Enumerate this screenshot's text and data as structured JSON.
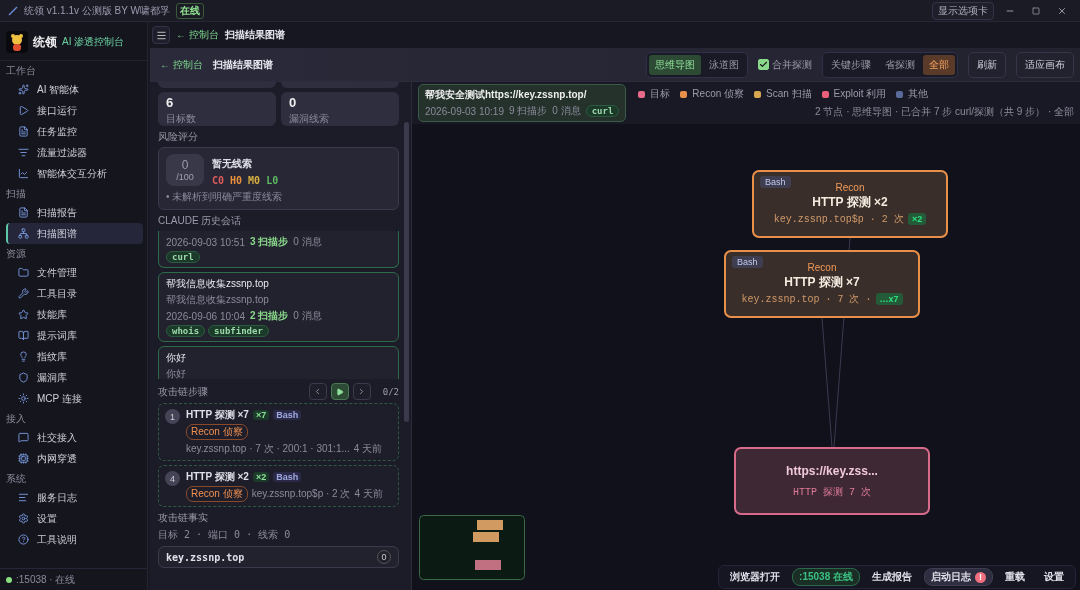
{
  "title_bar": {
    "title": "统领 v1.1.1v 公测版 BY W啸都孚",
    "status": "在线",
    "tabs_button": "显示选项卡"
  },
  "sidebar": {
    "brand": "统领",
    "subtitle": "AI 渗透控制台",
    "sections": [
      {
        "title": "工作台",
        "items": [
          {
            "label": "AI 智能体",
            "selected": false
          },
          {
            "label": "接口运行",
            "selected": false
          },
          {
            "label": "任务监控",
            "selected": false
          },
          {
            "label": "流量过滤器",
            "selected": false
          },
          {
            "label": "智能体交互分析",
            "selected": false
          }
        ]
      },
      {
        "title": "扫描",
        "items": [
          {
            "label": "扫描报告",
            "selected": false
          },
          {
            "label": "扫描图谱",
            "selected": true
          }
        ]
      },
      {
        "title": "资源",
        "items": [
          {
            "label": "文件管理",
            "selected": false
          },
          {
            "label": "工具目录",
            "selected": false
          },
          {
            "label": "技能库",
            "selected": false
          },
          {
            "label": "提示词库",
            "selected": false
          },
          {
            "label": "指纹库",
            "selected": false
          },
          {
            "label": "漏洞库",
            "selected": false
          },
          {
            "label": "MCP 连接",
            "selected": false
          }
        ]
      },
      {
        "title": "接入",
        "items": [
          {
            "label": "社交接入",
            "selected": false
          },
          {
            "label": "内网穿透",
            "selected": false
          }
        ]
      },
      {
        "title": "系统",
        "items": [
          {
            "label": "服务日志",
            "selected": false
          },
          {
            "label": "设置",
            "selected": false
          },
          {
            "label": "工具说明",
            "selected": false
          }
        ]
      }
    ],
    "footer": ":15038 · 在线"
  },
  "header": {
    "back": "← 控制台",
    "title": "扫描结果图谱"
  },
  "panel": {
    "back": "← 控制台",
    "title": "扫描结果图谱",
    "view_tabs": [
      {
        "label": "思维导图",
        "selected": true
      },
      {
        "label": "泳道图",
        "selected": false
      }
    ],
    "merge": {
      "label": "合并探测",
      "checked": true
    },
    "filter_tabs": [
      {
        "label": "关键步骤",
        "selected": false
      },
      {
        "label": "省探测",
        "selected": false
      },
      {
        "label": "全部",
        "selected": true
      }
    ],
    "buttons": [
      "刷新",
      "适应画布"
    ]
  },
  "summary": {
    "stats": [
      {
        "value": "6",
        "label": "目标数"
      },
      {
        "value": "0",
        "label": "漏洞线索"
      }
    ]
  },
  "risk": {
    "heading": "风险评分",
    "score": "0",
    "max": "/100",
    "title": "暂无线索",
    "levels": [
      {
        "label": "C0",
        "color": "#e05a5a"
      },
      {
        "label": "H0",
        "color": "#e8903a"
      },
      {
        "label": "M0",
        "color": "#d8b040"
      },
      {
        "label": "L0",
        "color": "#5cb860"
      }
    ],
    "note": "• 未解析到明确严重度线索"
  },
  "sessions": {
    "heading": "CLAUDE 历史会话",
    "items": [
      {
        "time": "2026-09-03 10:51",
        "steps": "3 扫描步",
        "messages": "0 消息",
        "tags": [
          "curl"
        ]
      },
      {
        "title": "帮我信息收集zssnp.top",
        "subtitle": "帮我信息收集zssnp.top",
        "time": "2026-09-06 10:04",
        "steps": "2 扫描步",
        "messages": "0 消息",
        "tags": [
          "whois",
          "subfinder"
        ]
      },
      {
        "title": "你好",
        "subtitle": "你好"
      }
    ]
  },
  "steps": {
    "heading": "攻击链步骤",
    "counter": "0/2",
    "items": [
      {
        "index": "1",
        "title": "HTTP 探测 ×7",
        "count": "×7",
        "tool": "Bash",
        "phase": "Recon 侦察",
        "detail": "key.zssnp.top · 7 次 · 200:1 · 301:1...",
        "age": "4 天前"
      },
      {
        "index": "4",
        "title": "HTTP 探测 ×2",
        "count": "×2",
        "tool": "Bash",
        "phase": "Recon 侦察",
        "detail": "key.zssnp.top$p · 2 次",
        "age": "4 天前"
      }
    ]
  },
  "facts": {
    "heading": "攻击链事实",
    "summary": "目标 2 · 端口 0 · 线索 0",
    "items": [
      {
        "host": "key.zssnp.top",
        "count": "0"
      }
    ]
  },
  "canvas": {
    "session": {
      "title": "帮我安全测试https://key.zssnp.top/",
      "time": "2026-09-03 10:19",
      "steps": "9 扫描步",
      "messages": "0 消息",
      "tag": "curl"
    },
    "legend": [
      {
        "label": "目标",
        "color": "#e86a88"
      },
      {
        "label": "Recon 侦察",
        "color": "#e8904a"
      },
      {
        "label": "Scan 扫描",
        "color": "#d9a650"
      },
      {
        "label": "Exploit 利用",
        "color": "#e8607a"
      },
      {
        "label": "其他",
        "color": "#5a6a9a"
      }
    ],
    "info": "2 节点 · 思维导图 · 已合并 7 步 curl/探测（共 9 步） · 全部",
    "nodes": [
      {
        "kind": "step",
        "tool": "Bash",
        "phase": "Recon",
        "title": "HTTP 探测 ×2",
        "detail": "key.zssnp.top$p · 2 次",
        "badge": "×2"
      },
      {
        "kind": "step",
        "tool": "Bash",
        "phase": "Recon",
        "title": "HTTP 探测 ×7",
        "detail": "key.zssnp.top · 7 次 ·",
        "badge": "…x7"
      },
      {
        "kind": "target",
        "title": "https://key.zss...",
        "detail": "HTTP 探测 7 次"
      }
    ]
  },
  "bottom_bar": {
    "items": [
      {
        "kind": "button",
        "label": "浏览器打开"
      },
      {
        "kind": "status",
        "label": ":15038 在线"
      },
      {
        "kind": "button",
        "label": "生成报告"
      },
      {
        "kind": "alert",
        "label": "启动日志",
        "badge": "!"
      },
      {
        "kind": "button",
        "label": "重载"
      },
      {
        "kind": "button",
        "label": "设置"
      }
    ]
  }
}
